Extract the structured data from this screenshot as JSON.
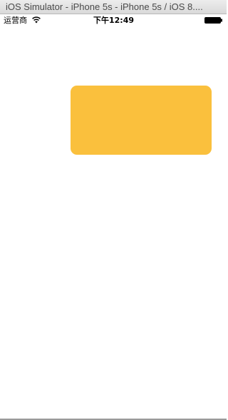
{
  "window": {
    "title": "iOS Simulator - iPhone 5s - iPhone 5s / iOS 8...."
  },
  "status_bar": {
    "carrier": "运营商",
    "wifi_icon": "wifi-icon",
    "time": "下午12:49",
    "battery_icon": "battery-icon"
  },
  "content": {
    "box_color": "#FAC03D"
  }
}
